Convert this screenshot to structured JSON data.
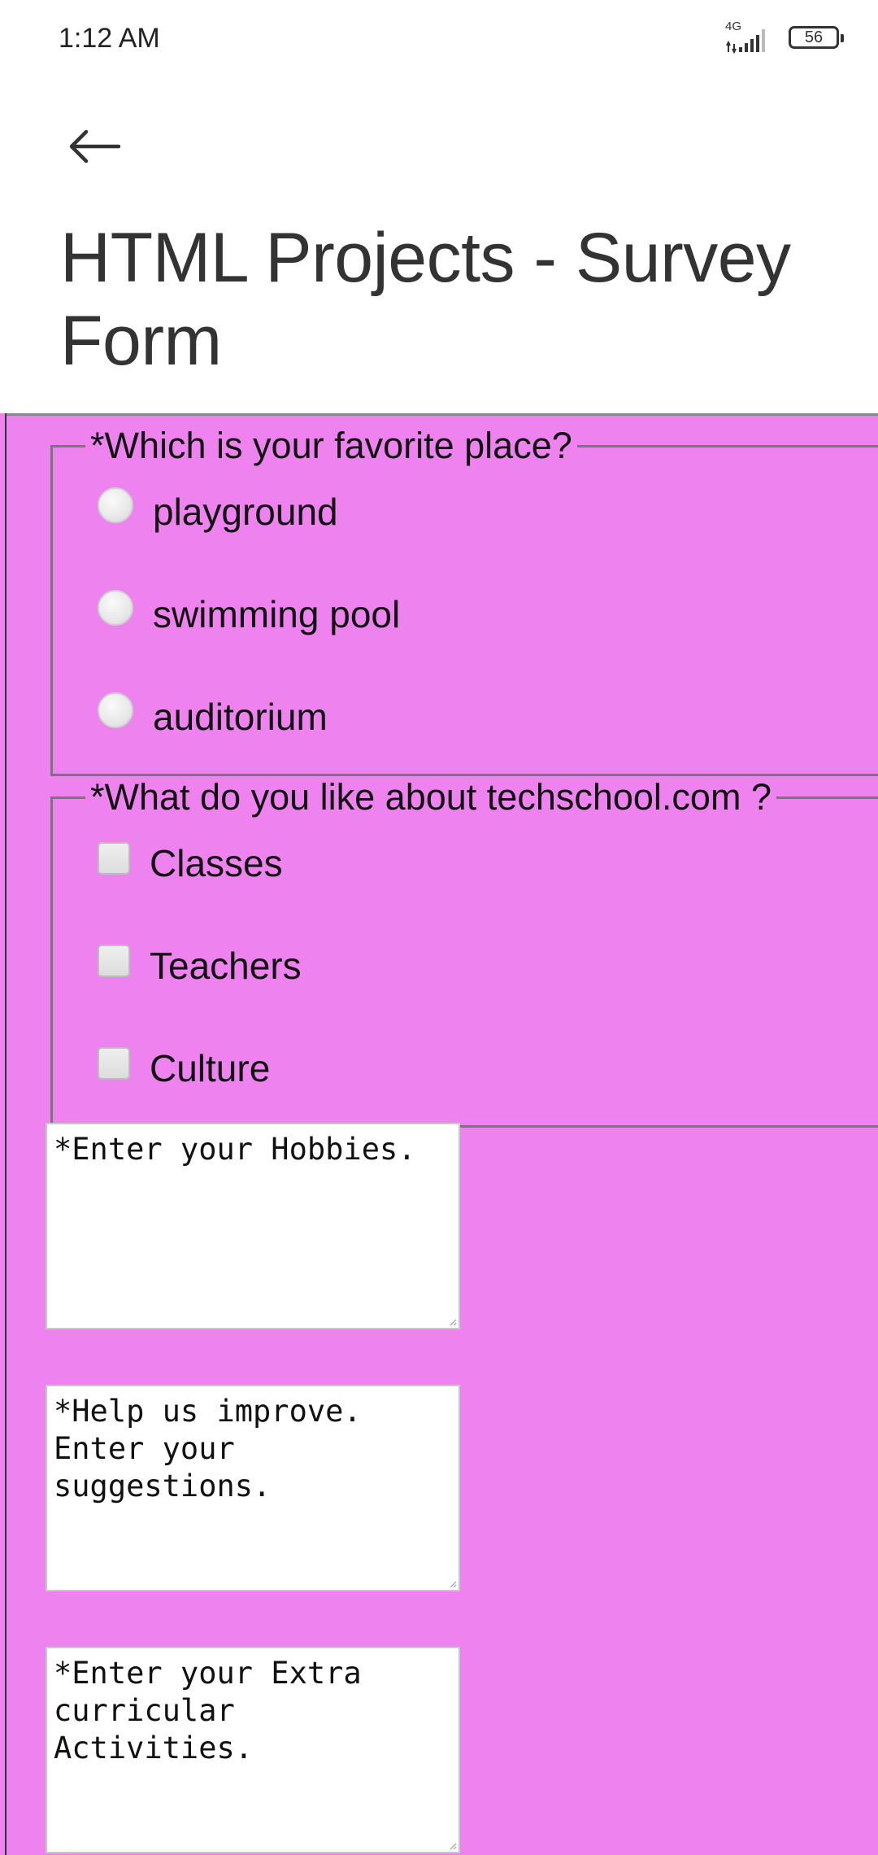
{
  "status_bar": {
    "time": "1:12 AM",
    "network": "4G",
    "battery": "56"
  },
  "header": {
    "back_icon": "arrow-left-icon",
    "title": "HTML Projects - Survey Form"
  },
  "form": {
    "background_color": "#ee82ee",
    "favorite_place": {
      "legend": "*Which is your favorite place?",
      "options": [
        "playground",
        "swimming pool",
        "auditorium"
      ]
    },
    "likes": {
      "legend": "*What do you like about techschool.com ?",
      "options": [
        "Classes",
        "Teachers",
        "Culture"
      ]
    },
    "textareas": {
      "hobbies": "*Enter your Hobbies.",
      "suggestions": "*Help us improve. Enter your suggestions.",
      "extracurricular": "*Enter your Extra curricular Activities."
    }
  }
}
